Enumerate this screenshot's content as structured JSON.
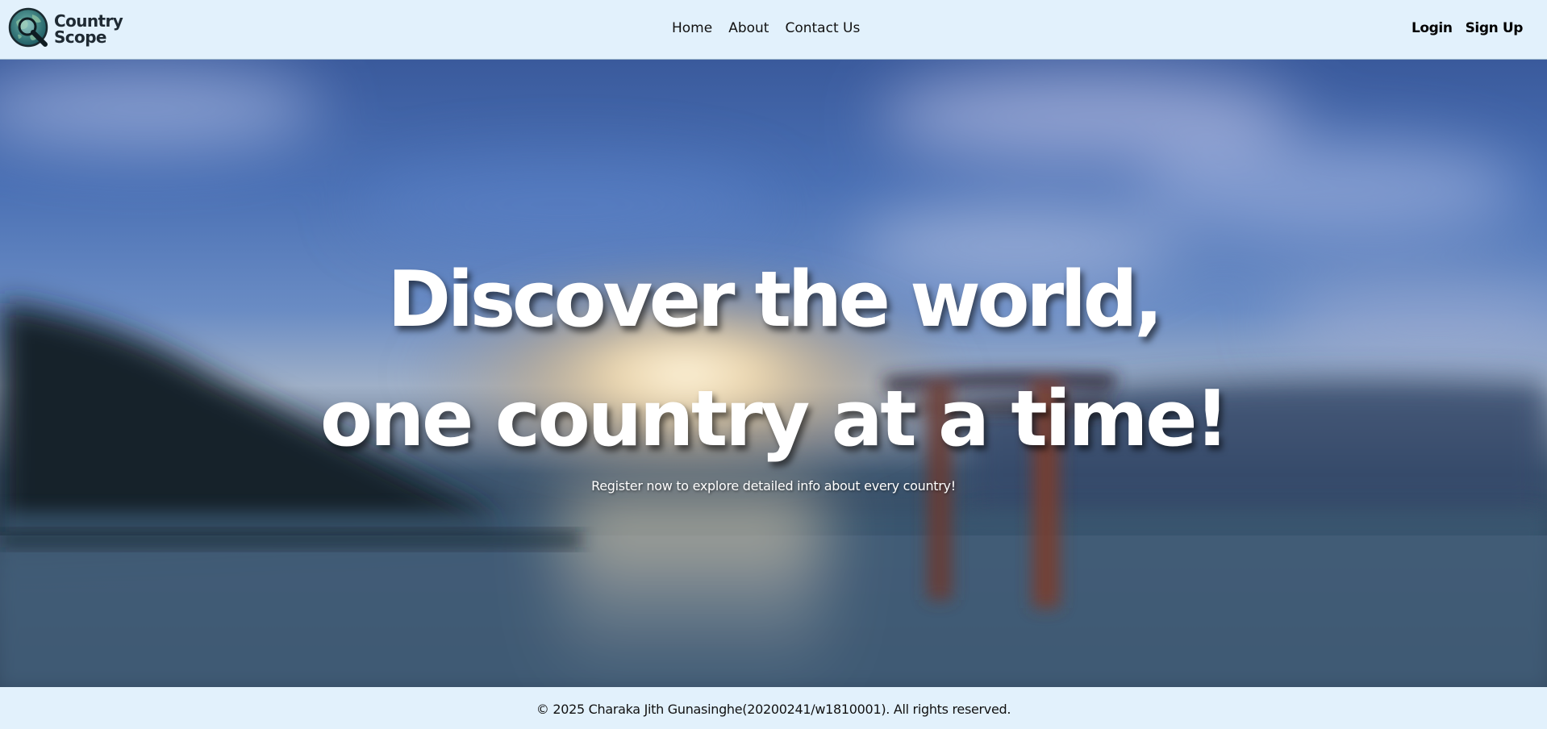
{
  "brand": {
    "name_line1": "Country",
    "name_line2": "Scope",
    "logo_icon": "globe-magnifier-icon",
    "logo_color": "#1b4f4c"
  },
  "nav": {
    "home": "Home",
    "about": "About",
    "contact": "Contact Us"
  },
  "auth": {
    "login": "Login",
    "signup": "Sign Up"
  },
  "hero": {
    "title_line1": "Discover the world,",
    "title_line2": "one country at a time!",
    "subtitle": "Register now to explore detailed info about every country!",
    "background_image": "blurred-torii-gate-sunset-lake"
  },
  "footer": {
    "copyright": "© 2025 Charaka Jith Gunasinghe(20200241/w1810001). All rights reserved."
  },
  "colors": {
    "header_bg": "#e2f1fc",
    "footer_bg": "#e2f1fc",
    "hero_text": "#ffffff"
  }
}
